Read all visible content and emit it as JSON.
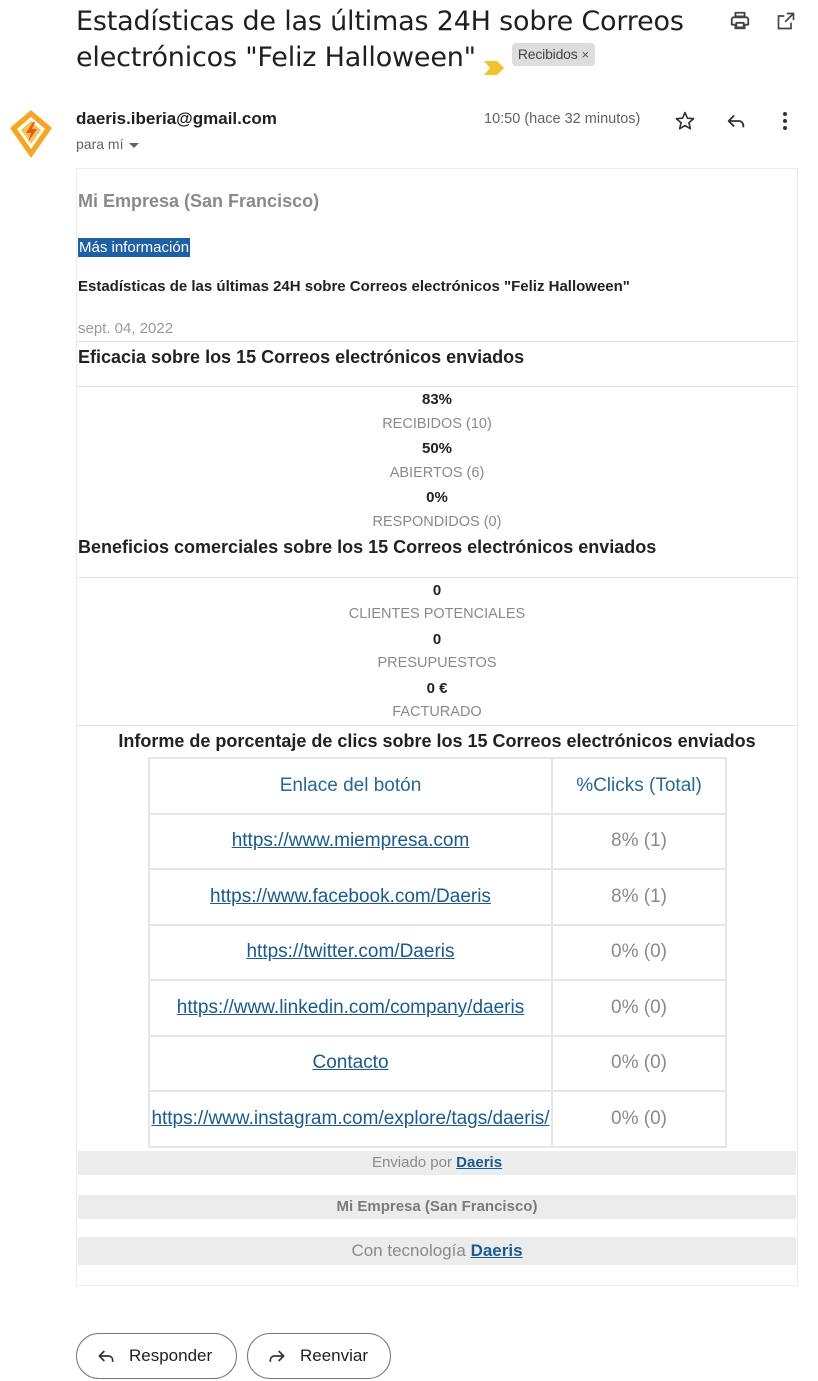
{
  "header": {
    "subject": "Estadísticas de las últimas 24H sobre Correos electrónicos \"Feliz Halloween\"",
    "label": "Recibidos",
    "label_close": "×"
  },
  "message": {
    "sender": "daeris.iberia@gmail.com",
    "recipient": "para mí",
    "time": "10:50 (hace 32 minutos)"
  },
  "email": {
    "company": "Mi Empresa (San Francisco)",
    "more_info": "Más información",
    "title": "Estadísticas de las últimas 24H sobre Correos electrónicos \"Feliz Halloween\"",
    "date": "sept. 04, 2022",
    "efficacy": {
      "title": "Eficacia sobre los 15 Correos electrónicos enviados",
      "stats": [
        {
          "value": "83%",
          "label": "RECIBIDOS (10)"
        },
        {
          "value": "50%",
          "label": "ABIERTOS (6)"
        },
        {
          "value": "0%",
          "label": "RESPONDIDOS (0)"
        }
      ]
    },
    "benefits": {
      "title": "Beneficios comerciales sobre los 15 Correos electrónicos enviados",
      "stats": [
        {
          "value": "0",
          "label": "CLIENTES POTENCIALES"
        },
        {
          "value": "0",
          "label": "PRESUPUESTOS"
        },
        {
          "value": "0 €",
          "label": "FACTURADO"
        }
      ]
    },
    "clicks": {
      "title": "Informe de porcentaje de clics sobre los 15 Correos electrónicos enviados",
      "headers": [
        "Enlace del botón",
        "%Clicks (Total)"
      ],
      "rows": [
        {
          "link": "https://www.miempresa.com",
          "pct": "8% (1)"
        },
        {
          "link": "https://www.facebook.com/Daeris",
          "pct": "8% (1)"
        },
        {
          "link": "https://twitter.com/Daeris",
          "pct": "0% (0)"
        },
        {
          "link": "https://www.linkedin.com/company/daeris",
          "pct": "0% (0)"
        },
        {
          "link": "Contacto",
          "pct": "0% (0)"
        },
        {
          "link": "https://www.instagram.com/explore/tags/daeris/",
          "pct": "0% (0)"
        }
      ]
    },
    "footer": {
      "sent_by_prefix": "Enviado por",
      "sent_by_link": "Daeris",
      "company": "Mi Empresa (San Francisco)",
      "powered_prefix": "Con tecnología",
      "powered_link": "Daeris"
    }
  },
  "actions": {
    "reply": "Responder",
    "forward": "Reenviar"
  },
  "icons": {
    "print": "print-icon",
    "open_new_window": "open-in-new-window-icon",
    "star": "star-icon",
    "reply": "reply-icon",
    "more": "more-vert-icon",
    "forward": "forward-icon",
    "importance": "importance-marker-icon"
  },
  "colors": {
    "link": "#1a5a8c",
    "more_info_bg": "#1f5fa4",
    "importance": "#f2c12e",
    "avatar_orange": "#f5a623"
  }
}
